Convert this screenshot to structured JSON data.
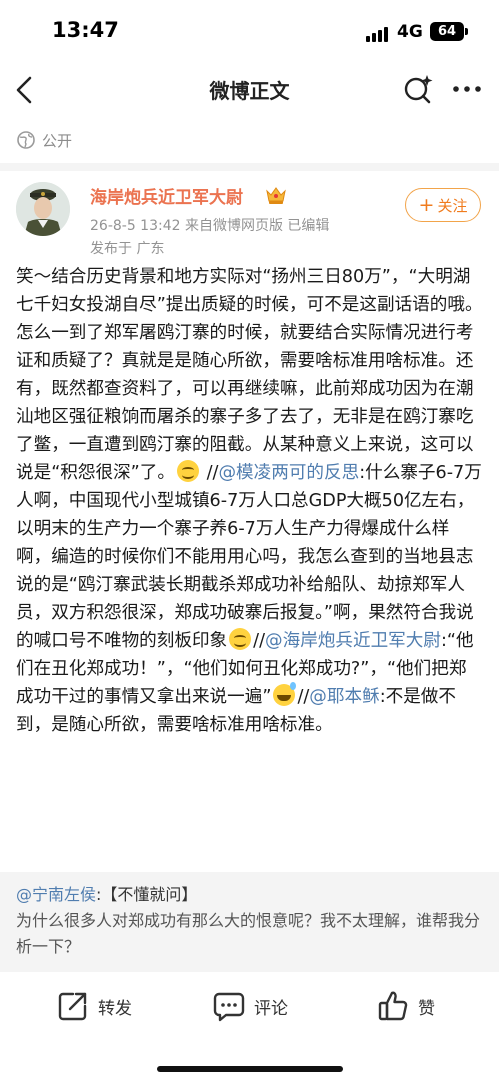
{
  "status": {
    "time": "13:47",
    "network": "4G",
    "battery": "64"
  },
  "nav": {
    "title": "微博正文"
  },
  "visibility": {
    "label": "公开"
  },
  "author": {
    "name": "海岸炮兵近卫军大尉",
    "meta": "26-8-5 13:42  来自微博网页版  已编辑",
    "location": "发布于 广东",
    "follow_label": "关注"
  },
  "post": {
    "text1": "笑～结合历史背景和地方实际对“扬州三日80万”，“大明湖七千妇女投湖自尽”提出质疑的时候，可不是这副话语的哦。怎么一到了郑军屠鸥汀寨的时候，就要结合实际情况进行考证和质疑了？真就是是随心所欲，需要啥标准用啥标准。还有，既然都查资料了，可以再继续嘛，此前郑成功因为在潮汕地区强征粮饷而屠杀的寨子多了去了，无非是在鸥汀寨吃了鳖，一直遭到鸥汀寨的阻截。从某种意义上来说，这可以说是“积怨很深”了。",
    "sep1": " //",
    "mention1": "@模凌两可的反思",
    "text2": ":什么寨子6-7万人啊，中国现代小型城镇6-7万人口总GDP大概50亿左右，以明末的生产力一个寨子养6-7万人生产力得爆成什么样啊，编造的时候你们不能用用心吗，我怎么查到的当地县志说的是“鸥汀寨武装长期截杀郑成功补给船队、劫掠郑军人员，双方积怨很深，郑成功破寨后报复。”啊，果然符合我说的喊口号不唯物的刻板印象",
    "sep2": "//",
    "mention2": "@海岸炮兵近卫军大尉",
    "text3": ":“他们在丑化郑成功！”，“他们如何丑化郑成功?”，“他们把郑成功干过的事情又拿出来说一遍”",
    "sep3": "//",
    "mention3": "@耶本稣",
    "text4": ":不是做不到，是随心所欲，需要啥标准用啥标准。"
  },
  "quote": {
    "mention": "@宁南左侯",
    "tag": ":【不懂就问】",
    "text": "为什么很多人对郑成功有那么大的恨意呢？我不太理解，谁帮我分析一下？"
  },
  "toolbar": {
    "repost": "转发",
    "comment": "评论",
    "like": "赞"
  },
  "colors": {
    "accent": "#eb7350",
    "link": "#507daf",
    "follow": "#f07b1d"
  }
}
